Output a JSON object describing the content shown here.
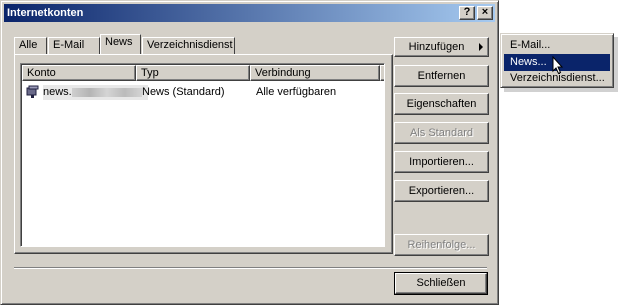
{
  "dialog": {
    "title": "Internetkonten",
    "help_btn": "?",
    "close_btn": "×"
  },
  "tabs": [
    {
      "label": "Alle"
    },
    {
      "label": "E-Mail"
    },
    {
      "label": "News"
    },
    {
      "label": "Verzeichnisdienst"
    }
  ],
  "list": {
    "columns": [
      "Konto",
      "Typ",
      "Verbindung"
    ],
    "rows": [
      {
        "konto": "news.",
        "typ": "News (Standard)",
        "verbindung": "Alle verfügbaren"
      }
    ]
  },
  "buttons": {
    "add": "Hinzufügen",
    "remove": "Entfernen",
    "properties": "Eigenschaften",
    "set_default": "Als Standard",
    "import": "Importieren...",
    "export": "Exportieren...",
    "order": "Reihenfolge...",
    "close": "Schließen"
  },
  "add_menu": {
    "items": [
      "E-Mail...",
      "News...",
      "Verzeichnisdienst..."
    ],
    "highlighted_index": 1
  },
  "colors": {
    "titlebar_start": "#0a246a",
    "titlebar_end": "#a6caf0",
    "face": "#d4d0c8",
    "highlight": "#0a246a"
  }
}
